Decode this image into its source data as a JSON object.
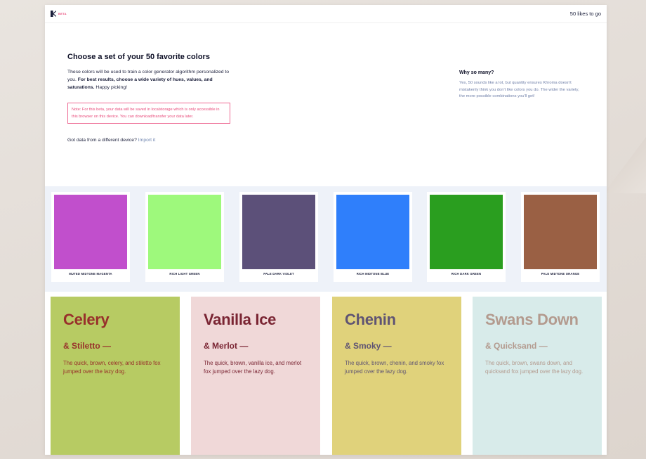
{
  "header": {
    "beta_label": "BETA",
    "likes_to_go": "50 likes to go"
  },
  "intro": {
    "title": "Choose a set of your 50 favorite colors",
    "text_1": "These colors will be used to train a color generator algorithm personalized to you. ",
    "text_bold": "For best results, choose a wide variety of hues, values, and saturations.",
    "text_2": " Happy picking!",
    "note": "Note: For this beta, your data will be saved in localstorage which is only accessible in this browser on this device. You can download/transfer your data later.",
    "import_prompt": "Got data from a different device?",
    "import_link": "Import it"
  },
  "why": {
    "title": "Why so many?",
    "text": "Yes, 50 sounds like a lot, but quantity ensures Khroma doesn't mistakenly think you don't like colors you do. The wider the variety, the more possible combinations you'll get!"
  },
  "swatches": [
    {
      "label": "MUTED MIDTONE MAGENTA",
      "color": "#c14fcc"
    },
    {
      "label": "RICH LIGHT GREEN",
      "color": "#9ef97c"
    },
    {
      "label": "PALE DARK VIOLET",
      "color": "#5c5079"
    },
    {
      "label": "RICH MIDTONE BLUE",
      "color": "#2f7ffb"
    },
    {
      "label": "RICH DARK GREEN",
      "color": "#2a9e1f"
    },
    {
      "label": "PALE MIDTONE ORANGE",
      "color": "#9a6044"
    }
  ],
  "cards": [
    {
      "title": "Celery",
      "subtitle": "& Stiletto —",
      "text": "The quick, brown, celery, and stiletto fox jumped over the lazy dog.",
      "bg": "#b7cb63",
      "fg": "#98302b"
    },
    {
      "title": "Vanilla Ice",
      "subtitle": "& Merlot —",
      "text": "The quick, brown, vanilla ice, and merlot fox jumped over the lazy dog.",
      "bg": "#f0d8d8",
      "fg": "#7a2533"
    },
    {
      "title": "Chenin",
      "subtitle": "& Smoky —",
      "text": "The quick, brown, chenin, and smoky fox jumped over the lazy dog.",
      "bg": "#e0d27b",
      "fg": "#5f5473"
    },
    {
      "title": "Swans Down",
      "subtitle": "& Quicksand —",
      "text": "The quick, brown, swans down, and quicksand fox jumped over the lazy dog.",
      "bg": "#d8ebea",
      "fg": "#b39a8e"
    }
  ]
}
